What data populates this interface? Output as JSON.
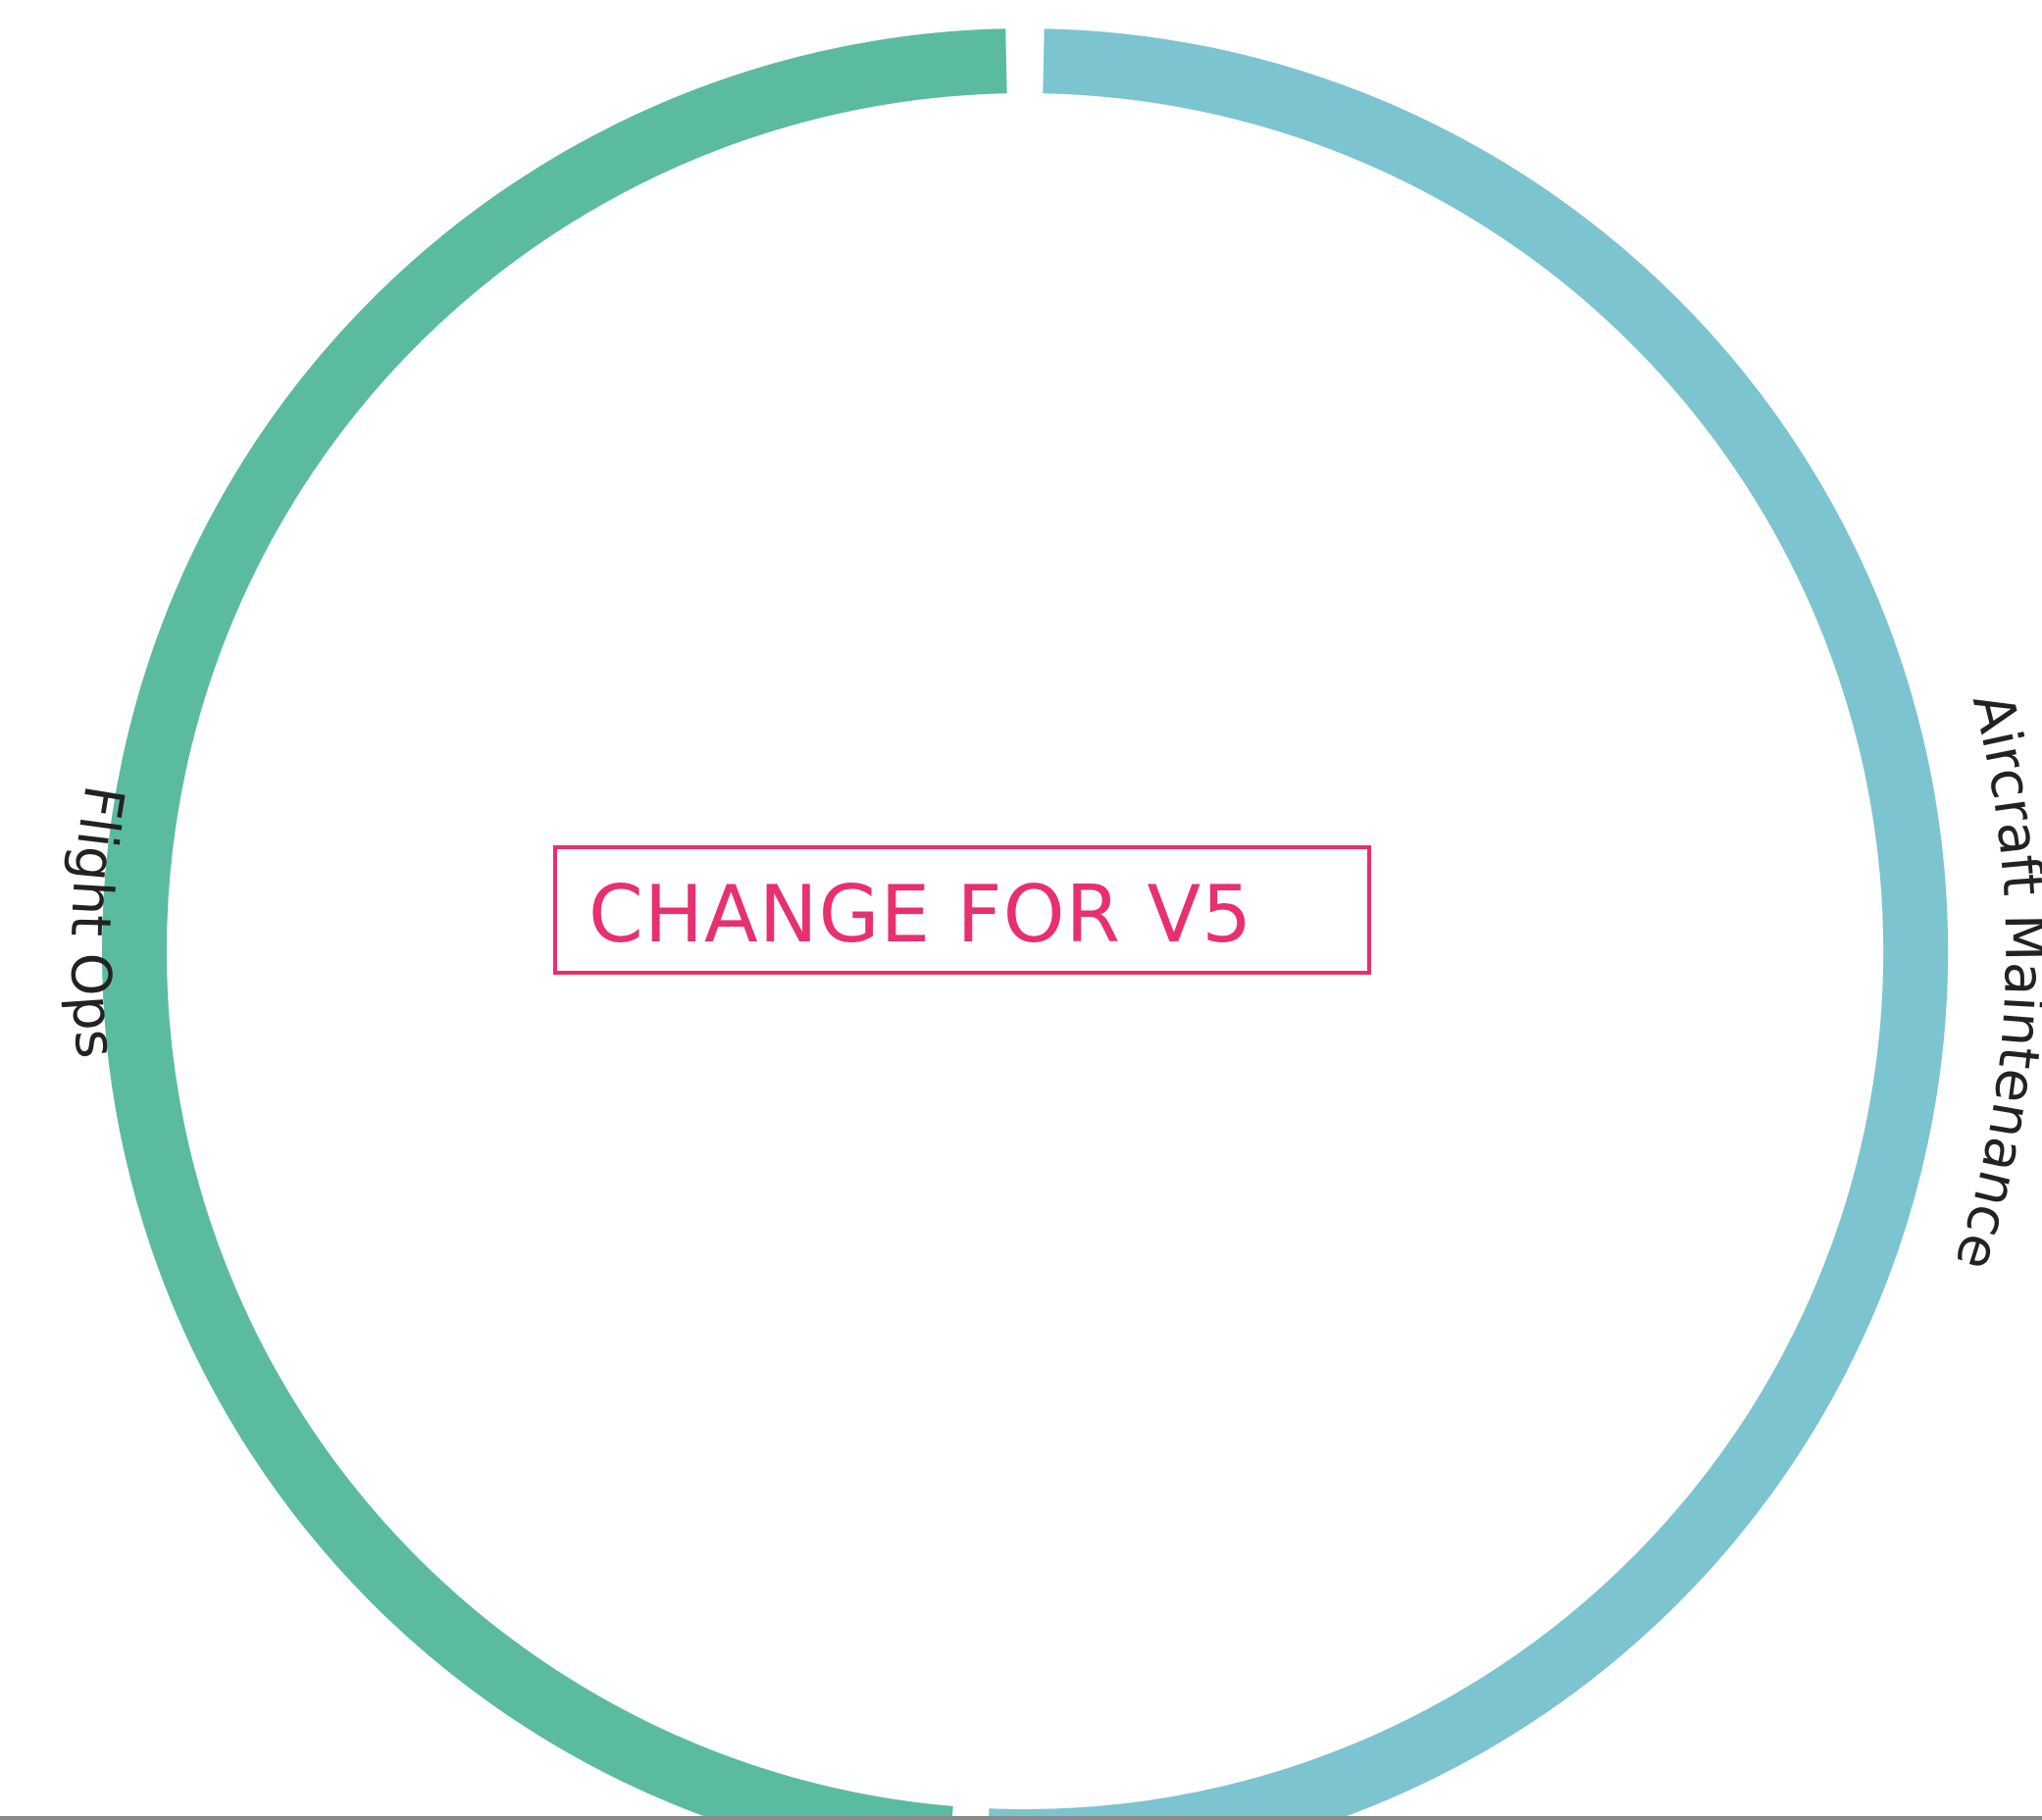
{
  "chart_data": {
    "type": "pie",
    "style": "donut-ring",
    "categories": [
      "Aircraft Maintenance",
      "Flight Ops"
    ],
    "values": [
      51,
      49
    ],
    "colors": [
      "#7cc4cf",
      "#5bbba0"
    ],
    "labels": [
      "Aircraft Maintenance",
      "Flight Ops"
    ],
    "label_placement": "outside, curved along ring"
  },
  "annotation": {
    "text": "CHANGE FOR V5",
    "color": "#e8306e"
  }
}
